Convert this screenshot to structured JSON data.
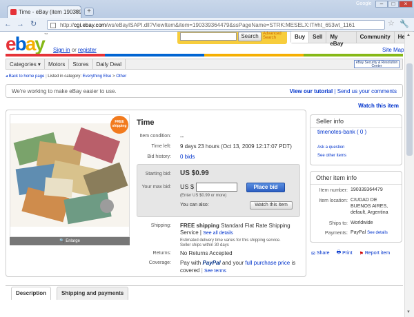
{
  "browser": {
    "tab_title": "Time - eBay (item 190339...",
    "close": "x",
    "newtab": "+",
    "google": "Google",
    "url_prefix": "http://",
    "url_host": "cgi.ebay.com",
    "url_path": "/ws/eBayISAPI.dll?ViewItem&item=190339364479&ssPageName=STRK:MESELX:IT#ht_653wt_1161",
    "back": "←",
    "forward": "→",
    "reload": "↻",
    "star": "☆"
  },
  "header": {
    "logo_letters": [
      "e",
      "b",
      "a",
      "y"
    ],
    "tm": "™",
    "sign_in": "Sign in",
    "or": " or ",
    "register": "register",
    "search_button": "Search",
    "advanced_search": "Advanced Search",
    "topnav": [
      "Buy",
      "Sell",
      "My eBay",
      "Community",
      "Help"
    ],
    "site_map": "Site Map"
  },
  "categories": [
    "Categories ▾",
    "Motors",
    "Stores",
    "Daily Deal"
  ],
  "security_badge": "eBay Security & Resolution Center",
  "breadcrumb": {
    "back": "Back to home page",
    "listed": "Listed in category:",
    "cat1": "Everything Else",
    "sep": ">",
    "cat2": "Other"
  },
  "infobar": {
    "message": "We're working to make eBay easier to use.",
    "tutorial": "View our tutorial",
    "sep": " | ",
    "comments": "Send us your comments"
  },
  "watch_link": "Watch this item",
  "free_shipping_badge": "FREE shipping",
  "enlarge": "Enlarge",
  "item": {
    "title": "Time",
    "condition_label": "Item condition:",
    "condition_value": "--",
    "time_left_label": "Time left:",
    "time_left_value": "9 days 23 hours (Oct 13, 2009   12:17:07 PDT)",
    "bid_history_label": "Bid history:",
    "bid_history_value": "0 bids",
    "starting_bid_label": "Starting bid:",
    "starting_bid_value": "US $0.99",
    "max_bid_label": "Your max bid:",
    "currency": "US $",
    "place_bid": "Place bid",
    "enter_hint": "(Enter US $0.99 or more)",
    "also_label": "You can also:",
    "watch_button": "Watch this item",
    "shipping_label": "Shipping:",
    "shipping_free": "FREE shipping",
    "shipping_method": " Standard Flat Rate Shipping Service",
    "shipping_sep": " | ",
    "see_all": "See all details",
    "ship_note1": "Estimated delivery time varies for this shipping service.",
    "ship_note2": "Seller ships within 30 days",
    "returns_label": "Returns:",
    "returns_value": "No Returns Accepted",
    "coverage_label": "Coverage:",
    "coverage_pre": "Pay with ",
    "paypal": "PayPal",
    "coverage_mid": " and your ",
    "coverage_link": "full purchase price",
    "coverage_post": " is",
    "covered": "covered",
    "see_terms": "See terms"
  },
  "seller": {
    "heading": "Seller info",
    "name": "timenotes-bank",
    "score": "( 0 )",
    "ask": "Ask a question",
    "other": "See other items"
  },
  "other_info": {
    "heading": "Other item info",
    "item_number_label": "Item number:",
    "item_number_value": "190339364479",
    "location_label": "Item location:",
    "location_value1": "CIUDAD DE",
    "location_value2": "BUENOS AIRES,",
    "location_value3": "default, Argentina",
    "ships_label": "Ships to:",
    "ships_value": "Worldwide",
    "payments_label": "Payments:",
    "payments_value": "PayPal",
    "see_details": "See details"
  },
  "share_row": [
    "Share",
    "Print",
    "Report item"
  ],
  "tabs": [
    "Description",
    "Shipping and payments"
  ],
  "colors": {
    "logo_e": "#e53238",
    "logo_b": "#0064d2",
    "logo_a": "#f5af02",
    "logo_y": "#86b817",
    "link": "#0033cc"
  }
}
